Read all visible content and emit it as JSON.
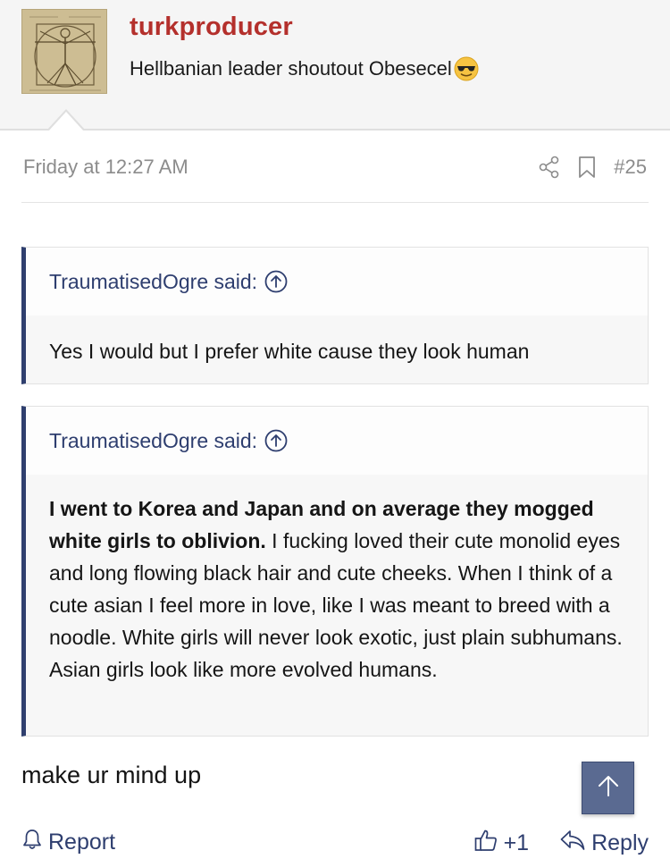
{
  "header": {
    "username": "turkproducer",
    "signature": "Hellbanian leader shoutout Obesecel"
  },
  "post": {
    "timestamp": "Friday at 12:27 AM",
    "post_number": "#25"
  },
  "quotes": [
    {
      "author_label": "TraumatisedOgre said:",
      "body": "Yes I would but I prefer white cause they look human"
    },
    {
      "author_label": "TraumatisedOgre said:",
      "body_bold": "I went to Korea and Japan and on average they mogged white girls to oblivion.",
      "body_rest": " I fucking loved their cute monolid eyes and long flowing black hair and cute cheeks. When I think of a cute asian I feel more in love, like I was meant to breed with a noodle. White girls will never look exotic, just plain subhumans. Asian girls look like more evolved humans."
    }
  ],
  "reply_text": "make ur mind up",
  "actions": {
    "report": "Report",
    "like_count": "+1",
    "reply": "Reply"
  },
  "colors": {
    "username": "#b4302c",
    "link": "#2e3e6f",
    "quote_bar": "#2f3f6e",
    "scroll_top_bg": "#5a6a91"
  },
  "icons": {
    "share": "share-icon",
    "bookmark": "bookmark-icon",
    "quote_jump": "arrow-up-circle-icon",
    "report": "bell-icon",
    "like": "thumbs-up-icon",
    "reply": "reply-arrow-icon",
    "scroll_top": "arrow-up-icon",
    "emoji": "sunglasses-emoji-icon"
  }
}
